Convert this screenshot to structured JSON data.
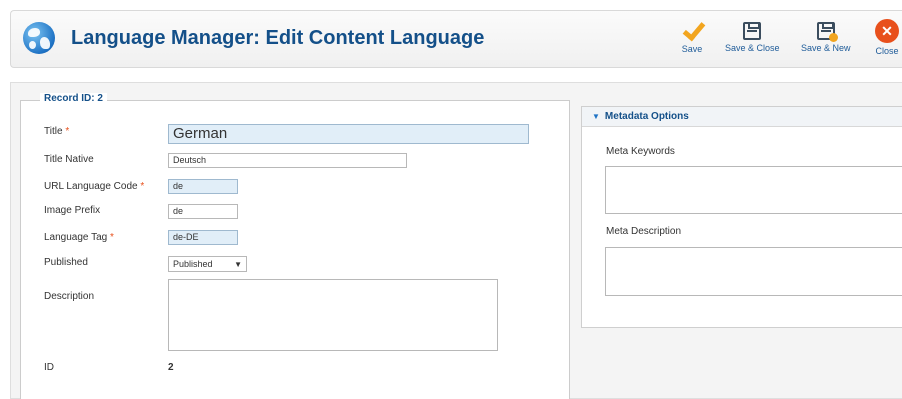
{
  "header": {
    "title": "Language Manager: Edit Content Language",
    "toolbar": {
      "save_label": "Save",
      "save_close_label": "Save & Close",
      "save_new_label": "Save & New",
      "close_label": "Close"
    }
  },
  "record": {
    "legend": "Record ID: 2",
    "fields": {
      "title": {
        "label": "Title",
        "value": "German",
        "required": true
      },
      "title_native": {
        "label": "Title Native",
        "value": "Deutsch"
      },
      "url_code": {
        "label": "URL Language Code",
        "value": "de",
        "required": true
      },
      "image_prefix": {
        "label": "Image Prefix",
        "value": "de"
      },
      "language_tag": {
        "label": "Language Tag",
        "value": "de-DE",
        "required": true
      },
      "published": {
        "label": "Published",
        "value": "Published"
      },
      "description": {
        "label": "Description",
        "value": ""
      },
      "id": {
        "label": "ID",
        "value": "2"
      }
    },
    "required_marker": "*"
  },
  "metadata": {
    "title": "Metadata Options",
    "keywords_label": "Meta Keywords",
    "description_label": "Meta Description"
  },
  "colors": {
    "brand_blue": "#145089",
    "required_star": "#e8501c",
    "required_field_bg": "#e1eef8",
    "save_icon": "#f2a51f",
    "close_icon": "#e8501c"
  },
  "icons": [
    "globe-icon",
    "check-icon",
    "save-close-icon",
    "save-new-icon",
    "close-icon",
    "chevron-down-icon"
  ]
}
